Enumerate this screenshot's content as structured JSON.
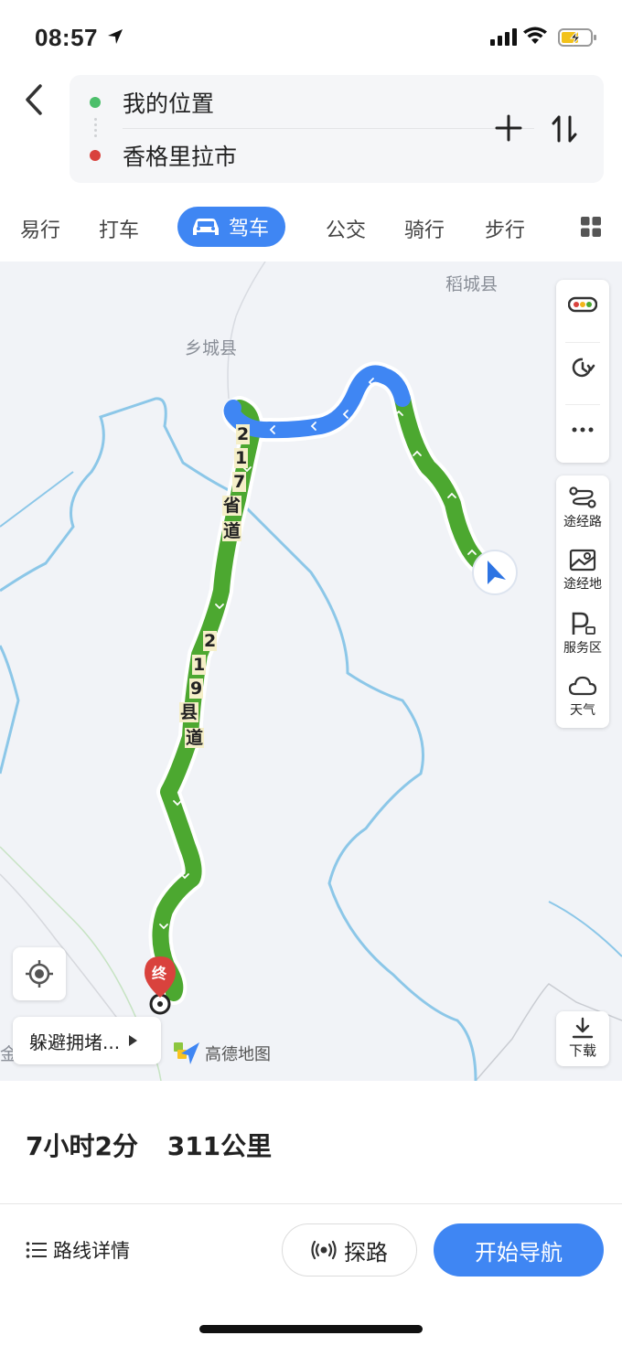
{
  "status_bar": {
    "time": "08:57"
  },
  "route": {
    "origin": "我的位置",
    "destination": "香格里拉市",
    "origin_color": "#4cbf6b",
    "destination_color": "#d9423d"
  },
  "modes": {
    "items": [
      "易行",
      "打车",
      "驾车",
      "公交",
      "骑行",
      "步行"
    ],
    "active": "驾车",
    "accent": "#3f86f3"
  },
  "map": {
    "labels": {
      "daocheng": "稻城县",
      "xiangcheng": "乡城县",
      "jin": "金"
    },
    "roads": {
      "road_217": [
        "2",
        "1",
        "7",
        "省",
        "道"
      ],
      "road_219": [
        "2",
        "1",
        "9",
        "县",
        "道"
      ]
    },
    "end_marker": "终",
    "route_colors": {
      "smooth": "#4ca830",
      "slow": "#3f86f3",
      "boundary": "#8cc7e8"
    },
    "tools": {
      "traffic_icon": "traffic-light-icon",
      "history_icon": "clock-refresh-icon",
      "more_icon": "more-icon",
      "waypoint_route": "途经路",
      "waypoint_place": "途经地",
      "service_area": "服务区",
      "weather": "天气",
      "download": "下载"
    },
    "avoid_congestion": "躲避拥堵...",
    "brand": "高德地图"
  },
  "summary": {
    "duration": "7小时2分",
    "distance": "311公里"
  },
  "actions": {
    "details": "路线详情",
    "explore": "探路",
    "start_navigation": "开始导航"
  }
}
